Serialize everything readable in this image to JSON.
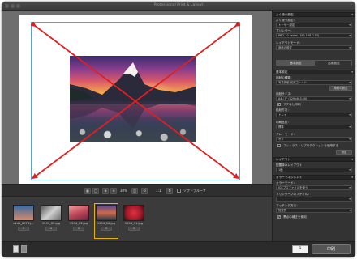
{
  "window": {
    "title": "Professional Print & Layout"
  },
  "canvas": {
    "paper_label": "A4ノビ (329x483.00)"
  },
  "toolbar": {
    "zoom_label": "30%",
    "ratio_label": "1:1",
    "softproof_label": "ソフトプルーフ"
  },
  "thumbnails": [
    {
      "caption": "c4d3_8076.j...",
      "count": "1",
      "color1": "#3a6aa0",
      "color2": "#d88a6a"
    },
    {
      "caption": "1504_02.jpg",
      "count": "1",
      "color1": "#8a8a8a",
      "color2": "#d0d0d0"
    },
    {
      "caption": "1504_03.jpg",
      "count": "1",
      "color1": "#c04a5a",
      "color2": "#f0a0a0"
    },
    {
      "caption": "1504_06.jpg",
      "count": "1",
      "color1": "#d06a4a",
      "color2": "#5a4a8a"
    },
    {
      "caption": "1504_11.jpg",
      "count": "1",
      "color1": "#a01a2a",
      "color2": "#e03040"
    }
  ],
  "bottom": {
    "copies": "1",
    "print_label": "印刷"
  },
  "panel": {
    "top_section": "よく使う設定",
    "labels": {
      "favorite": "よく使う設定：",
      "printer": "プリンター：",
      "layout_mode": "レイアウトモード："
    },
    "selects": {
      "favorite": "トーザー設定",
      "printer": "PRO-10 series (192.168.0.13)",
      "layout_mode": "用紙の設定"
    },
    "tabs": [
      "基本設定",
      "応用設定"
    ],
    "section_basic": "基本設定",
    "labels2": {
      "paper_type": "用紙の種類：",
      "paper_size": "用紙サイズ：",
      "borderless": "フチなし印刷",
      "paper_feed": "給紙方法：",
      "print_quality": "印刷品質：",
      "color_mode": "グレーモード：",
      "contrast": "コントラストリプロダクションを使用する"
    },
    "selects2": {
      "paper_type": "写真用紙 光沢ゴールド",
      "paper_size": "A4ノビ (329x483.00)",
      "paper_feed": "トレイ",
      "print_quality": "標準",
      "color_mode": "オフ"
    },
    "buttons": {
      "media_settings": "用紙の設定",
      "settings": "設定"
    },
    "section_layout": "レイアウト",
    "labels3": {
      "layout": "配置済みレイアウト："
    },
    "selects3": {
      "layout": "1面"
    },
    "section_color": "カラーマネジメント",
    "labels4": {
      "color_mode": "カラーモード：",
      "printer_profile": "プリンタープロファイル：",
      "matching": "マッチング方法：",
      "black_point": "黒点の補正を使用"
    },
    "selects4": {
      "color_mode": "ICCプロファイルを使う",
      "printer_profile": "",
      "matching": "知覚的"
    }
  }
}
